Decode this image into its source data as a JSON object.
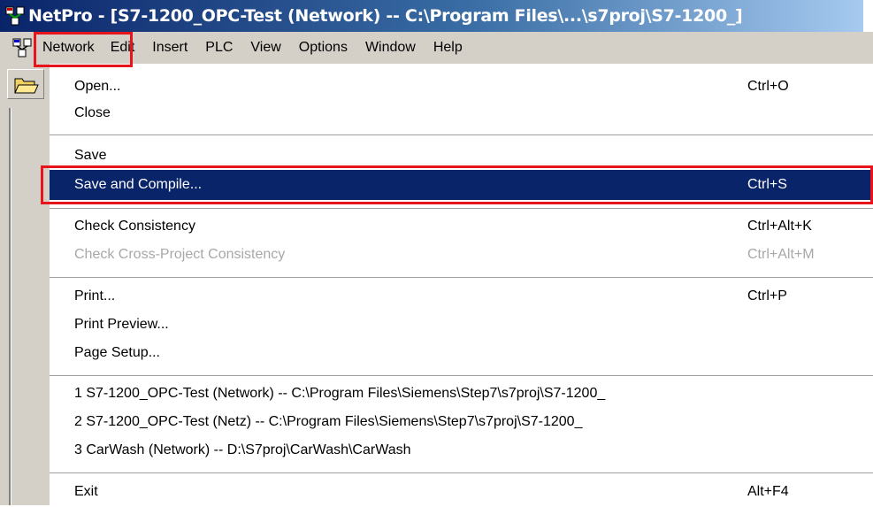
{
  "window": {
    "title": "NetPro - [S7-1200_OPC-Test (Network) -- C:\\Program Files\\...\\s7proj\\S7-1200_]"
  },
  "menubar": {
    "items": [
      "Network",
      "Edit",
      "Insert",
      "PLC",
      "View",
      "Options",
      "Window",
      "Help"
    ],
    "active": "Network"
  },
  "network_menu": {
    "open": {
      "label": "Open...",
      "shortcut": "Ctrl+O"
    },
    "close": {
      "label": "Close"
    },
    "save": {
      "label": "Save"
    },
    "save_compile": {
      "label": "Save and Compile...",
      "shortcut": "Ctrl+S"
    },
    "check_consistency": {
      "label": "Check Consistency",
      "shortcut": "Ctrl+Alt+K"
    },
    "check_cross": {
      "label": "Check Cross-Project Consistency",
      "shortcut": "Ctrl+Alt+M"
    },
    "print": {
      "label": "Print...",
      "shortcut": "Ctrl+P"
    },
    "print_preview": {
      "label": "Print Preview..."
    },
    "page_setup": {
      "label": "Page Setup..."
    },
    "recent": [
      "1 S7-1200_OPC-Test (Network) -- C:\\Program Files\\Siemens\\Step7\\s7proj\\S7-1200_",
      "2 S7-1200_OPC-Test (Netz) -- C:\\Program Files\\Siemens\\Step7\\s7proj\\S7-1200_",
      "3 CarWash (Network) -- D:\\S7proj\\CarWash\\CarWash"
    ],
    "exit": {
      "label": "Exit",
      "shortcut": "Alt+F4"
    }
  },
  "colors": {
    "title_gradient_start": "#0a246a",
    "selection": "#0a246a",
    "highlight_box": "#e8141c",
    "menu_background": "#d4d0c8"
  }
}
